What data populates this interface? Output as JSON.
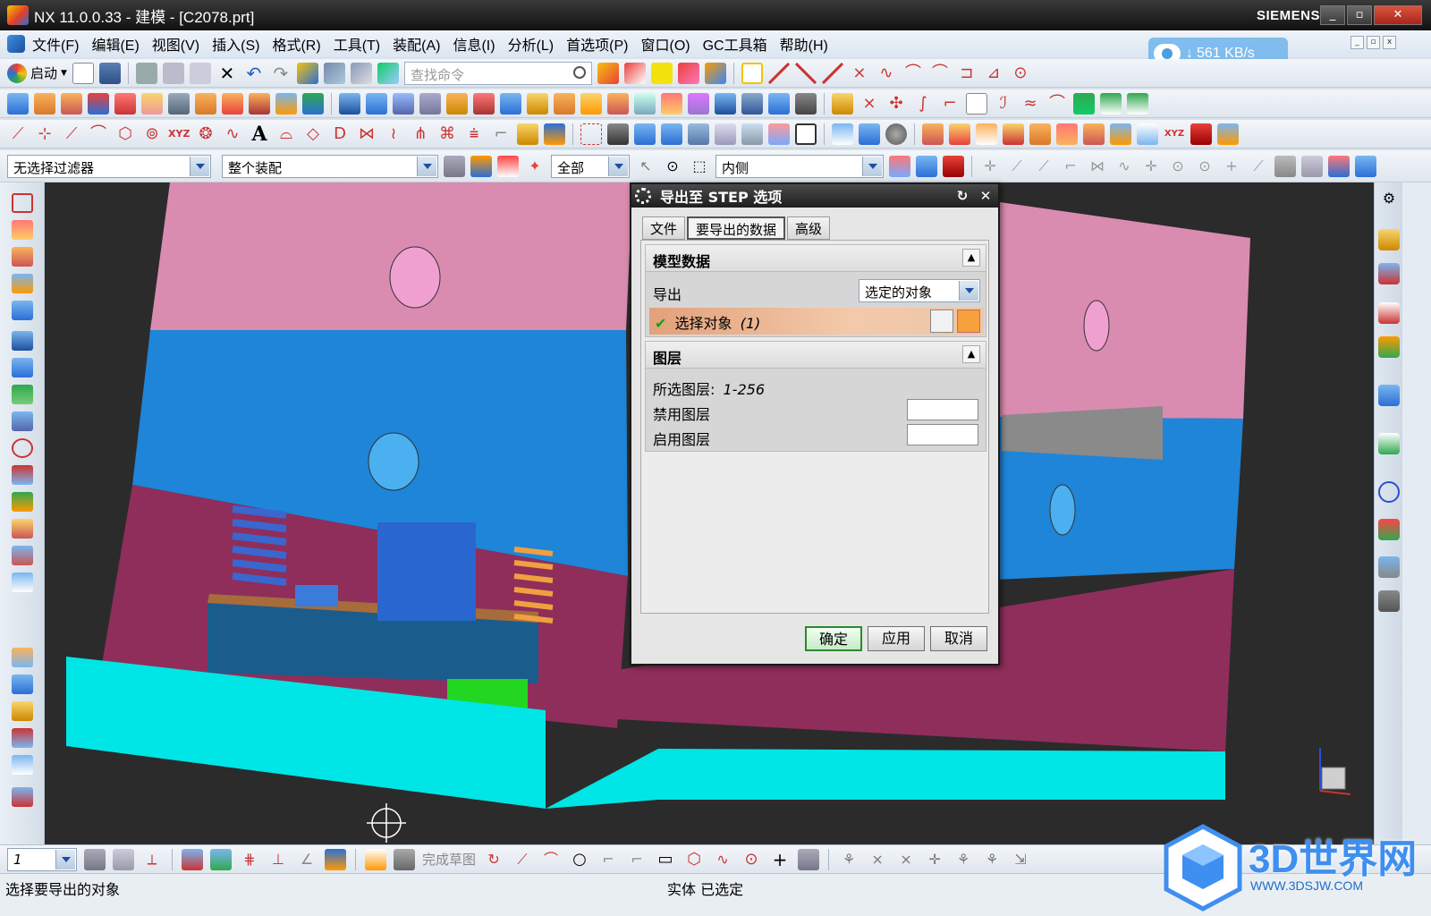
{
  "window": {
    "title": "NX 11.0.0.33 - 建模 - [C2078.prt]",
    "brand": "SIEMENS",
    "minimize": "_",
    "restore": "▫",
    "close": "✕"
  },
  "menu": [
    "文件(F)",
    "编辑(E)",
    "视图(V)",
    "插入(S)",
    "格式(R)",
    "工具(T)",
    "装配(A)",
    "信息(I)",
    "分析(L)",
    "首选项(P)",
    "窗口(O)",
    "GC工具箱",
    "帮助(H)"
  ],
  "network_badge": {
    "text": "561 KB/s",
    "arrow": "↓"
  },
  "toolbar": {
    "start_label": "启动",
    "search_placeholder": "查找命令"
  },
  "filterbar": {
    "type_filter": "无选择过滤器",
    "scope": "整个装配",
    "layer_filter": "全部",
    "snap_mode": "内侧"
  },
  "dialog": {
    "title": "导出至 STEP 选项",
    "tabs": [
      "文件",
      "要导出的数据",
      "高级"
    ],
    "active_tab": 1,
    "model_group": {
      "header": "模型数据",
      "export_label": "导出",
      "export_value": "选定的对象",
      "select_label": "选择对象",
      "select_count": "(1)"
    },
    "layer_group": {
      "header": "图层",
      "selected_layers_label": "所选图层:",
      "selected_layers_value": "1-256",
      "disabled_layers_label": "禁用图层",
      "enabled_layers_label": "启用图层",
      "disabled_layers_value": "",
      "enabled_layers_value": ""
    },
    "buttons": {
      "ok": "确定",
      "apply": "应用",
      "cancel": "取消"
    }
  },
  "bottombar": {
    "view_number": "1",
    "finish_sketch": "完成草图"
  },
  "status": {
    "prompt": "选择要导出的对象",
    "selection": "实体 已选定"
  },
  "watermark": {
    "name": "3D世界网",
    "url": "WWW.3DSJW.COM"
  }
}
